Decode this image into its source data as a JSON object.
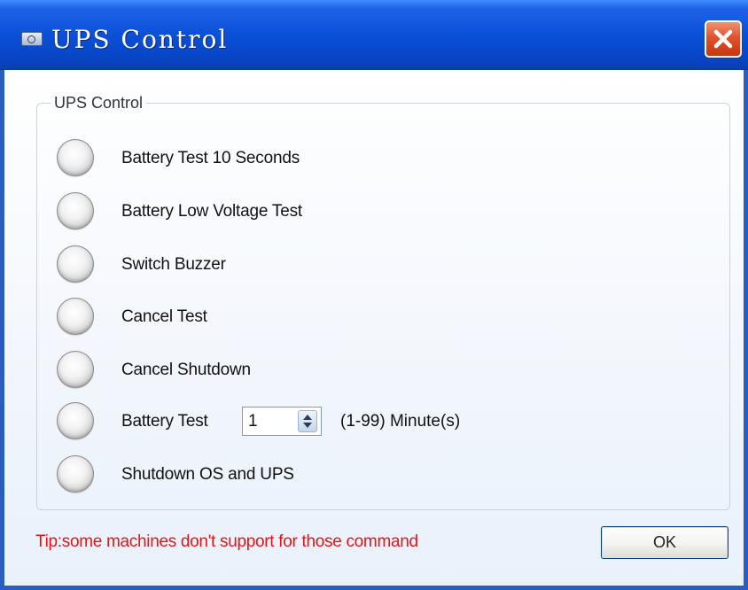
{
  "window": {
    "title": "UPS Control",
    "icon": "window-app-icon",
    "close_icon": "close-icon",
    "title_color": "#0a50d8",
    "close_color": "#e0532c"
  },
  "group": {
    "legend": "UPS Control",
    "options": [
      {
        "label": "Battery Test 10 Seconds",
        "selected": false
      },
      {
        "label": "Battery Low Voltage Test",
        "selected": false
      },
      {
        "label": "Switch Buzzer",
        "selected": false
      },
      {
        "label": "Cancel Test",
        "selected": false
      },
      {
        "label": "Cancel Shutdown",
        "selected": false
      },
      {
        "label": "Battery Test",
        "selected": false
      },
      {
        "label": "Shutdown OS and UPS",
        "selected": false
      }
    ],
    "battery_test_minutes": {
      "value": "1",
      "range_label": "(1-99) Minute(s)",
      "spinner_icon": "spinner-updown-icon"
    }
  },
  "tip": {
    "text": "Tip:some machines don't support for those command",
    "color": "#ee1111"
  },
  "buttons": {
    "ok_label": "OK"
  }
}
